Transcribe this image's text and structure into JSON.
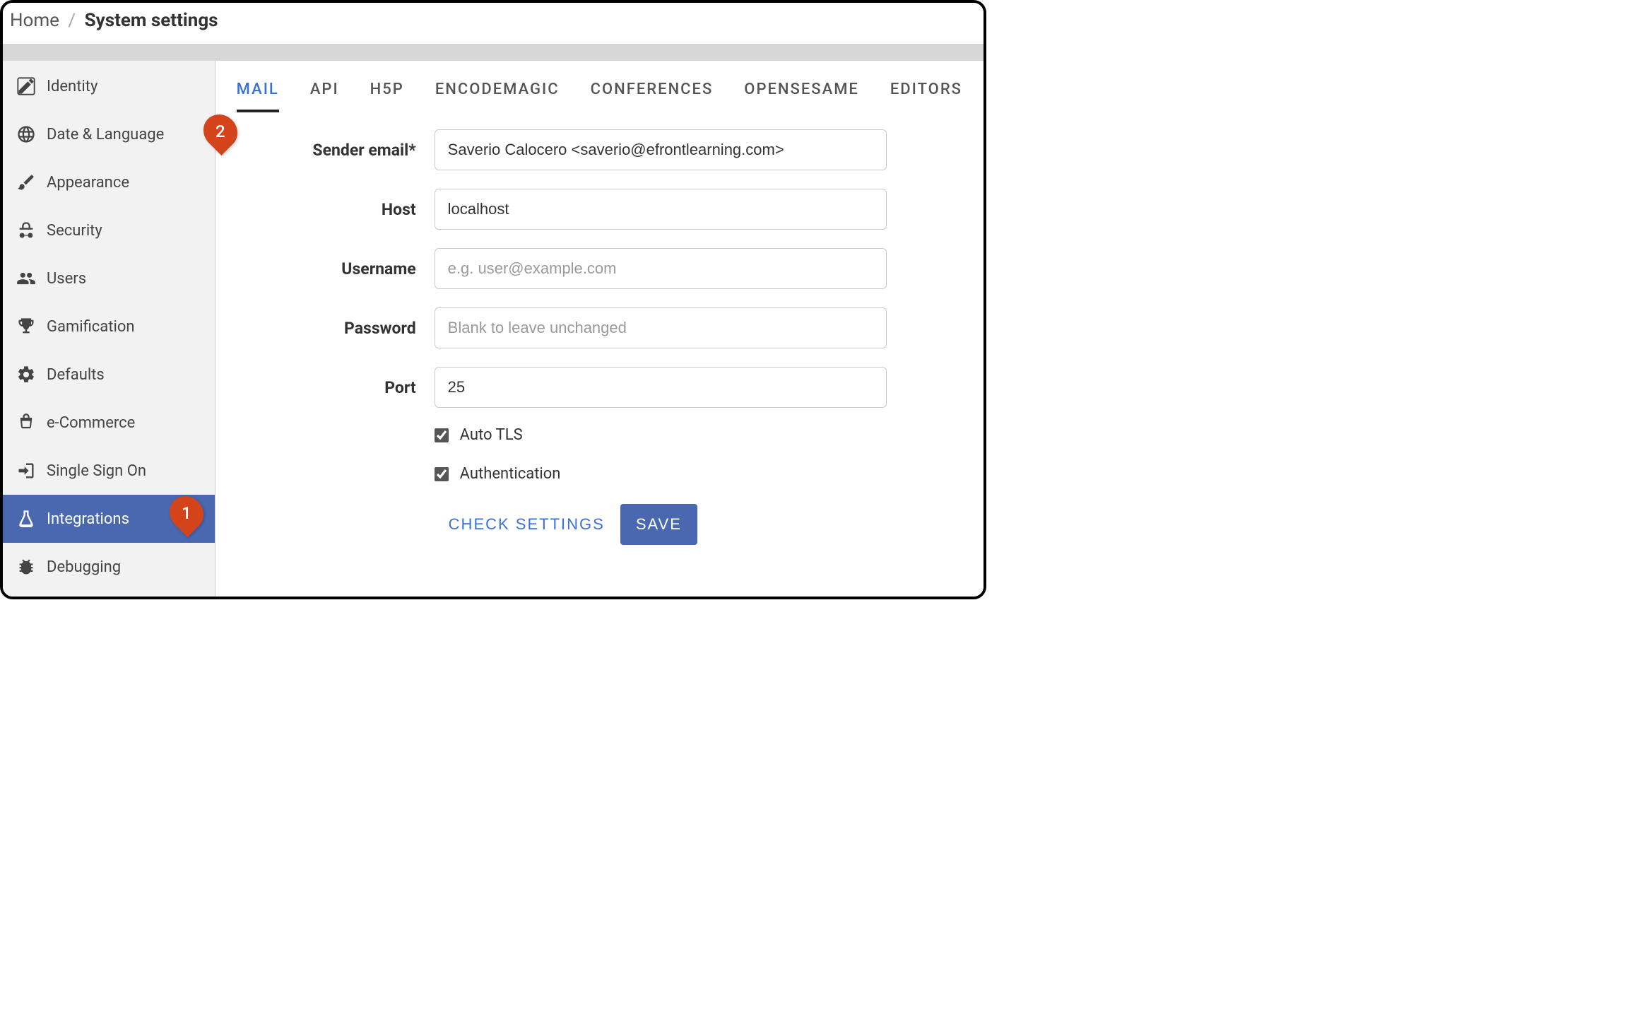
{
  "breadcrumb": {
    "home": "Home",
    "separator": "/",
    "current": "System settings"
  },
  "sidebar": {
    "items": [
      {
        "label": "Identity",
        "icon": "edit-icon"
      },
      {
        "label": "Date & Language",
        "icon": "globe-icon"
      },
      {
        "label": "Appearance",
        "icon": "brush-icon"
      },
      {
        "label": "Security",
        "icon": "spy-icon"
      },
      {
        "label": "Users",
        "icon": "users-icon"
      },
      {
        "label": "Gamification",
        "icon": "trophy-icon"
      },
      {
        "label": "Defaults",
        "icon": "cogs-icon"
      },
      {
        "label": "e-Commerce",
        "icon": "cart-icon"
      },
      {
        "label": "Single Sign On",
        "icon": "signin-icon"
      },
      {
        "label": "Integrations",
        "icon": "flask-icon",
        "active": true
      },
      {
        "label": "Debugging",
        "icon": "bug-icon"
      }
    ]
  },
  "tabs": [
    {
      "label": "MAIL",
      "active": true
    },
    {
      "label": "API"
    },
    {
      "label": "H5P"
    },
    {
      "label": "ENCODEMAGIC"
    },
    {
      "label": "CONFERENCES"
    },
    {
      "label": "OPENSESAME"
    },
    {
      "label": "EDITORS"
    }
  ],
  "form": {
    "sender_email": {
      "label": "Sender email*",
      "value": "Saverio Calocero <saverio@efrontlearning.com>"
    },
    "host": {
      "label": "Host",
      "value": "localhost"
    },
    "username": {
      "label": "Username",
      "value": "",
      "placeholder": "e.g. user@example.com"
    },
    "password": {
      "label": "Password",
      "value": "",
      "placeholder": "Blank to leave unchanged"
    },
    "port": {
      "label": "Port",
      "value": "25"
    },
    "auto_tls": {
      "label": "Auto TLS",
      "checked": true
    },
    "authentication": {
      "label": "Authentication",
      "checked": true
    }
  },
  "actions": {
    "check": "CHECK SETTINGS",
    "save": "SAVE"
  },
  "annotations": {
    "badge1": "1",
    "badge2": "2"
  }
}
